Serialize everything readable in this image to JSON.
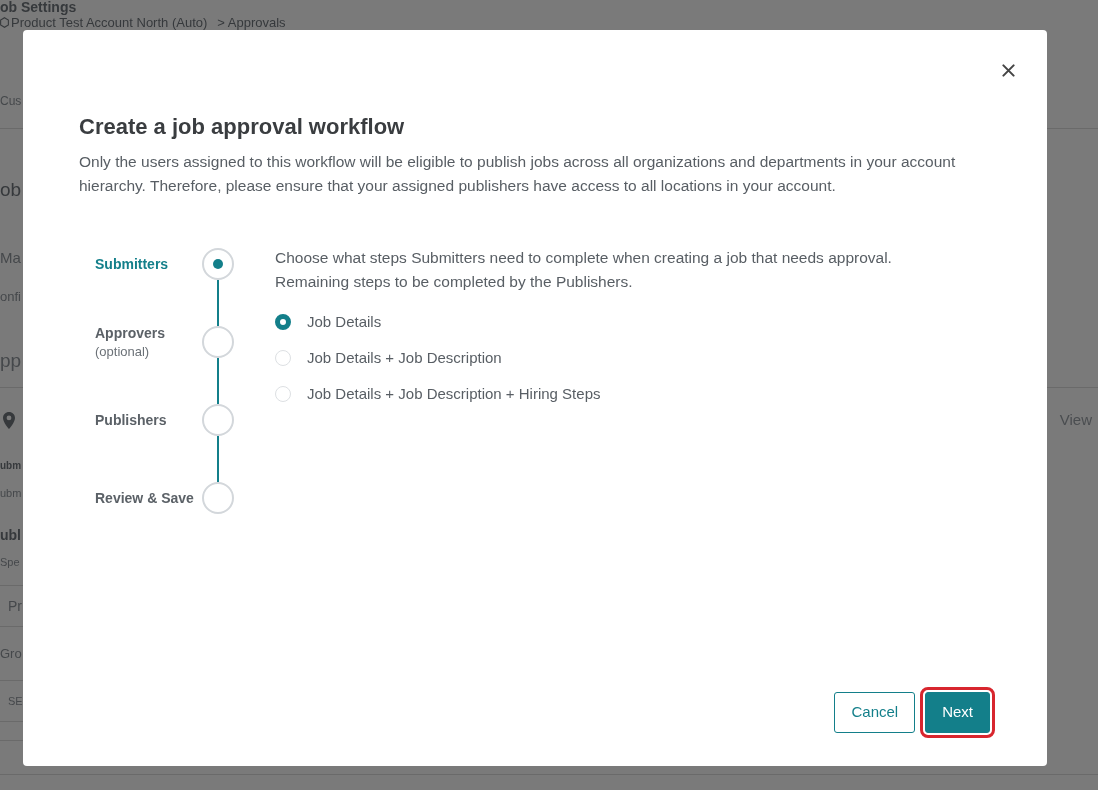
{
  "background": {
    "title": "ob Settings",
    "breadcrumb": {
      "account": "Product Test Account North (Auto)",
      "current": "> Approvals"
    },
    "tab": "Cus",
    "heading": "ob",
    "subheading": "Ma",
    "note": "onfi",
    "section": "pp",
    "link": "View",
    "rows": [
      {
        "kind": "heading",
        "text": "ubm"
      },
      {
        "kind": "detail",
        "text": "ubm"
      },
      {
        "kind": "heading",
        "text": "ubl"
      },
      {
        "kind": "detail",
        "text": "Spe"
      },
      {
        "kind": "cell",
        "text": "Pr"
      },
      {
        "kind": "group",
        "text": "Gro"
      },
      {
        "kind": "cell",
        "text": "SE"
      }
    ]
  },
  "modal": {
    "title": "Create a job approval workflow",
    "description": "Only the users assigned to this workflow will be eligible to publish jobs across all organizations and departments in your account hierarchy. Therefore, please ensure that your assigned publishers have access to all locations in your account.",
    "steps": [
      {
        "label": "Submitters",
        "selected": true
      },
      {
        "label": "Approvers",
        "note": "(optional)",
        "selected": false
      },
      {
        "label": "Publishers",
        "selected": false
      },
      {
        "label": "Review & Save",
        "selected": false
      }
    ],
    "prompt": [
      "Choose what steps Submitters need to complete when creating a job that needs approval.",
      "Remaining steps to be completed by the Publishers."
    ],
    "options": [
      {
        "label": "Job Details",
        "selected": true
      },
      {
        "label": "Job Details + Job Description",
        "selected": false
      },
      {
        "label": "Job Details + Job Description + Hiring Steps",
        "selected": false
      }
    ],
    "buttons": [
      {
        "label": "Cancel",
        "kind": "outline",
        "focused": false
      },
      {
        "label": "Next",
        "kind": "primary",
        "focused": true
      }
    ]
  }
}
